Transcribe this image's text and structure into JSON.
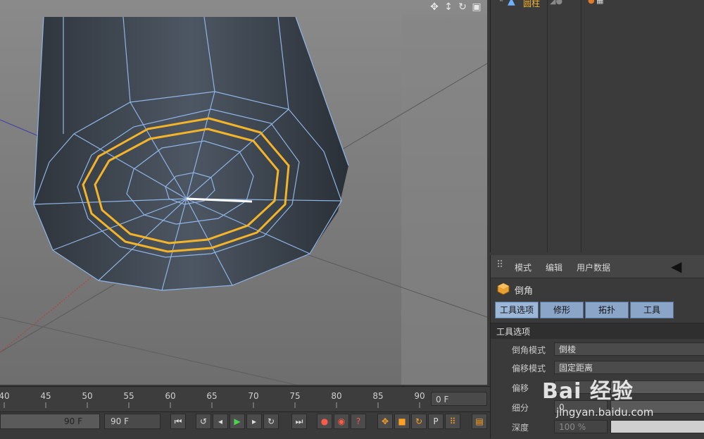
{
  "object_manager": {
    "object_name": "圆柱"
  },
  "attribute_manager": {
    "menus": [
      "模式",
      "编辑",
      "用户数据"
    ],
    "tool_name": "倒角",
    "tabs": [
      "工具选项",
      "修形",
      "拓扑",
      "工具"
    ],
    "section_title": "工具选项",
    "params": [
      {
        "label": "倒角模式",
        "value": "倒棱"
      },
      {
        "label": "偏移模式",
        "value": "固定距离"
      },
      {
        "label": "偏移",
        "value": ""
      },
      {
        "label": "细分",
        "value": "0"
      },
      {
        "label": "深度",
        "value": "100 %"
      }
    ]
  },
  "timeline": {
    "ticks": [
      "40",
      "45",
      "50",
      "55",
      "60",
      "65",
      "70",
      "75",
      "80",
      "85",
      "90"
    ],
    "current_frame": "0 F",
    "preview_end": "90 F",
    "end_frame": "90 F"
  },
  "watermark": {
    "brand": "Bai 经验",
    "url": "jingyan.baidu.com"
  },
  "colors": {
    "selection": "#f4b42a",
    "wire": "#8fb4e6",
    "mesh": "#4a5561"
  }
}
